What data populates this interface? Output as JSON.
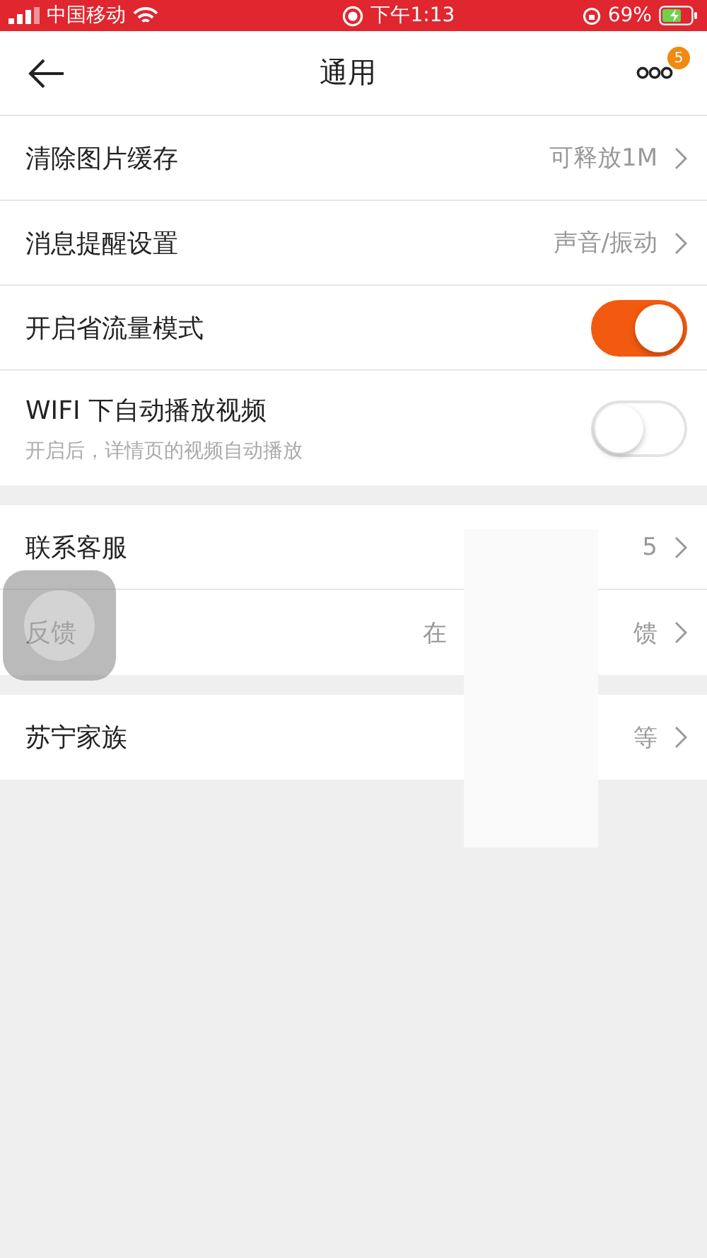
{
  "status_bar": {
    "carrier": "中国移动",
    "time": "下午1:13",
    "battery": "69%"
  },
  "nav": {
    "title": "通用",
    "badge": "5"
  },
  "sections": [
    {
      "rows": [
        {
          "kind": "value",
          "label": "清除图片缓存",
          "value_parts": [
            "可释放1M"
          ]
        },
        {
          "kind": "value",
          "label": "消息提醒设置",
          "value_parts": [
            "声音/振动"
          ]
        },
        {
          "kind": "toggle",
          "label": "开启省流量模式",
          "on": true
        },
        {
          "kind": "toggle",
          "label": "WIFI 下自动播放视频",
          "subtitle": "开启后，详情页的视频自动播放",
          "on": false
        }
      ]
    },
    {
      "rows": [
        {
          "kind": "value",
          "label": "联系客服",
          "value_parts": [
            "5"
          ]
        },
        {
          "kind": "value",
          "label": "反馈",
          "value_parts": [
            "在",
            "馈"
          ]
        }
      ]
    },
    {
      "rows": [
        {
          "kind": "value",
          "label": "苏宁家族",
          "value_parts": [
            "等"
          ]
        }
      ]
    }
  ]
}
